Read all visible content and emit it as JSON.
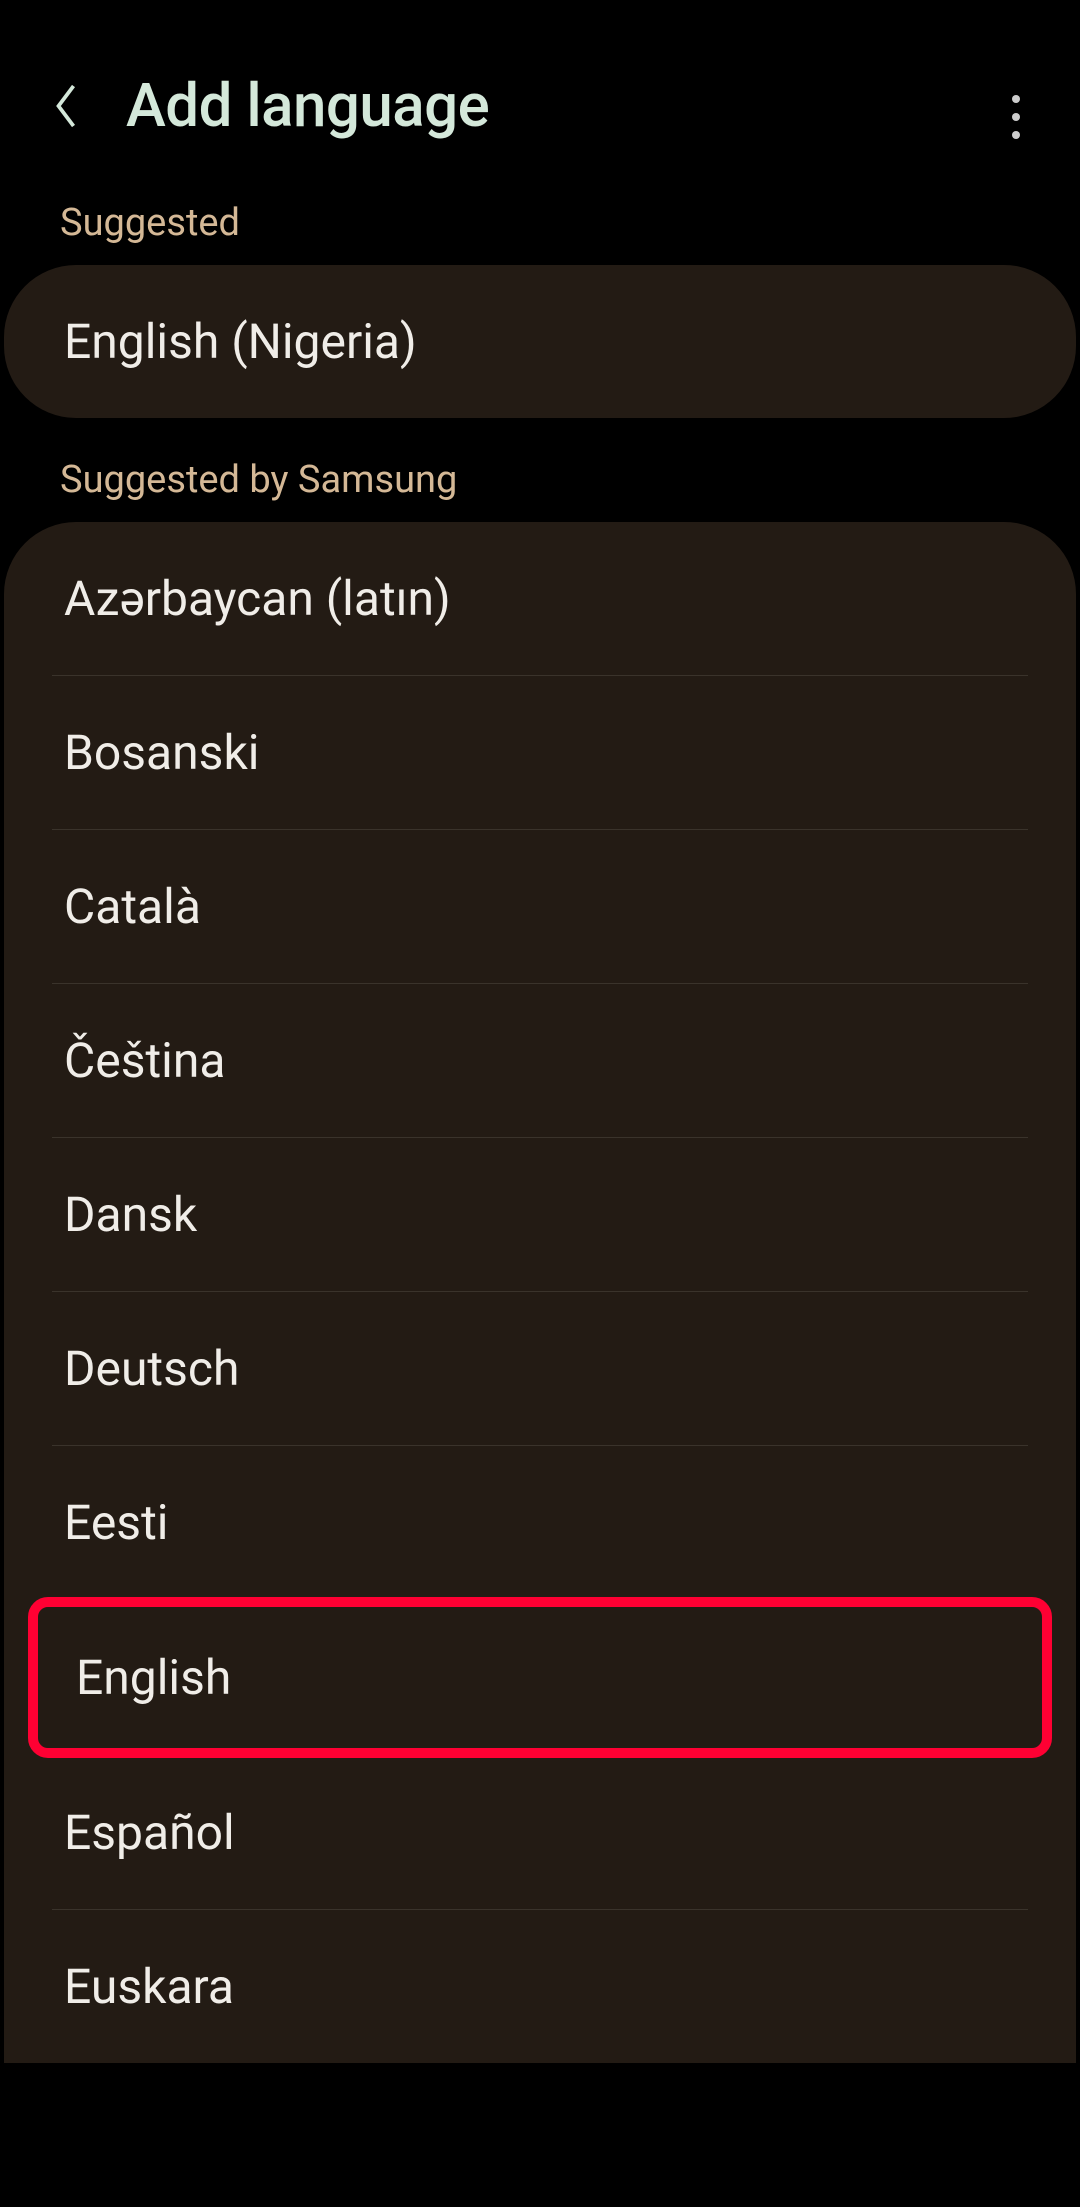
{
  "header": {
    "title": "Add language"
  },
  "sections": {
    "suggested": {
      "label": "Suggested",
      "items": [
        {
          "label": "English (Nigeria)"
        }
      ]
    },
    "samsung": {
      "label": "Suggested by Samsung",
      "items": [
        {
          "label": "Azərbaycan (latın)"
        },
        {
          "label": "Bosanski"
        },
        {
          "label": "Català"
        },
        {
          "label": "Čeština"
        },
        {
          "label": "Dansk"
        },
        {
          "label": "Deutsch"
        },
        {
          "label": "Eesti"
        },
        {
          "label": "English",
          "highlighted": true
        },
        {
          "label": "Español"
        },
        {
          "label": "Euskara"
        }
      ]
    }
  }
}
